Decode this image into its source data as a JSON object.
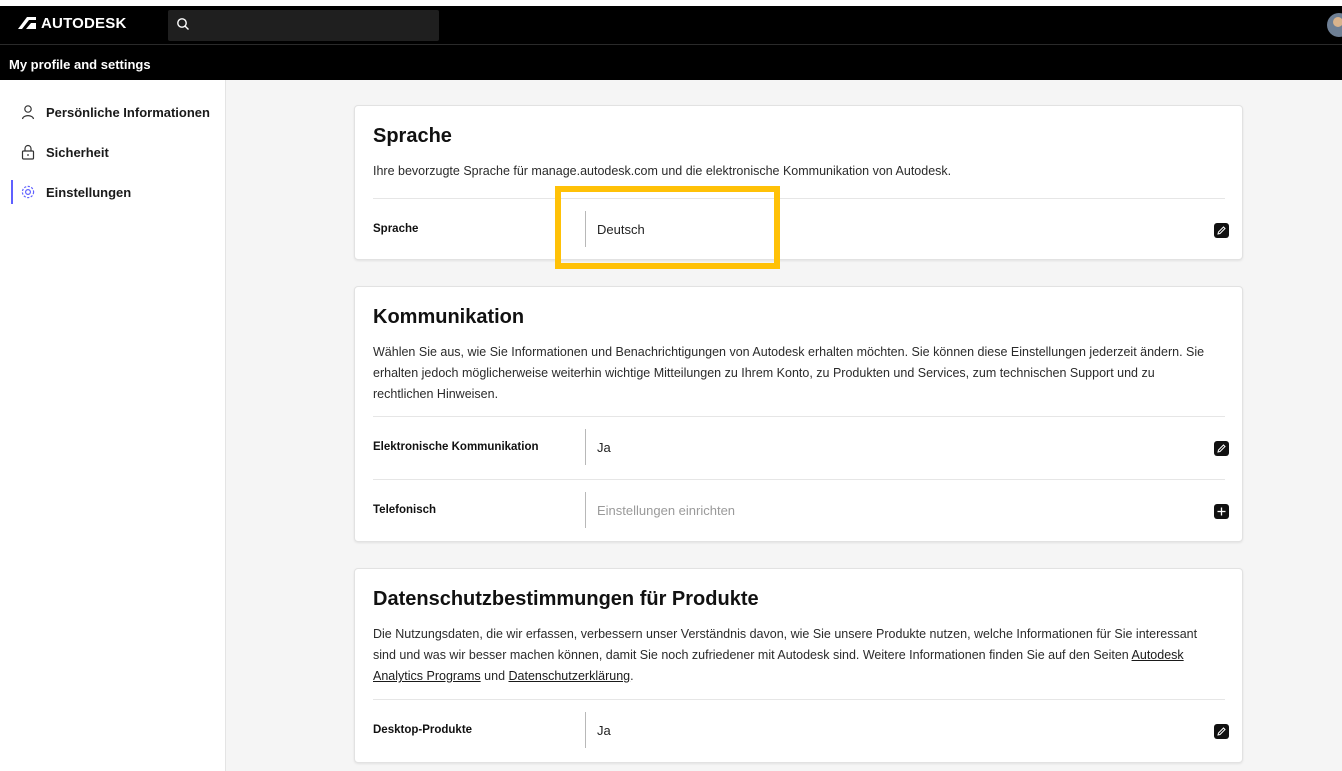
{
  "header": {
    "brand": "AUTODESK",
    "search_placeholder": "",
    "subtitle": "My profile and settings"
  },
  "sidebar": {
    "items": [
      {
        "label": "Persönliche Informationen",
        "icon": "person-icon",
        "active": false
      },
      {
        "label": "Sicherheit",
        "icon": "lock-icon",
        "active": false
      },
      {
        "label": "Einstellungen",
        "icon": "gear-icon",
        "active": true
      }
    ]
  },
  "sections": {
    "language": {
      "title": "Sprache",
      "description": "Ihre bevorzugte Sprache für manage.autodesk.com und die elektronische Kommunikation von Autodesk.",
      "rows": [
        {
          "label": "Sprache",
          "value": "Deutsch",
          "action": "edit-icon"
        }
      ]
    },
    "communication": {
      "title": "Kommunikation",
      "description": "Wählen Sie aus, wie Sie Informationen und Benachrichtigungen von Autodesk erhalten möchten. Sie können diese Einstellungen jederzeit ändern. Sie erhalten jedoch möglicherweise weiterhin wichtige Mitteilungen zu Ihrem Konto, zu Produkten und Services, zum technischen Support und zu rechtlichen Hinweisen.",
      "rows": [
        {
          "label": "Elektronische Kommunikation",
          "value": "Ja",
          "action": "edit-icon"
        },
        {
          "label": "Telefonisch",
          "value": "Einstellungen einrichten",
          "action": "plus-icon"
        }
      ]
    },
    "privacy": {
      "title": "Datenschutzbestimmungen für Produkte",
      "description_before": "Die Nutzungsdaten, die wir erfassen, verbessern unser Verständnis davon, wie Sie unsere Produkte nutzen, welche Informationen für Sie interessant sind und was wir besser machen können, damit Sie noch zufriedener mit Autodesk sind. Weitere Informationen finden Sie auf den Seiten ",
      "link1": "Autodesk Analytics Programs",
      "description_mid": " und ",
      "link2": "Datenschutzerklärung",
      "description_after": ".",
      "rows": [
        {
          "label": "Desktop-Produkte",
          "value": "Ja",
          "action": "edit-icon"
        }
      ]
    }
  },
  "colors": {
    "highlight": "#ffc107",
    "active_indicator": "#5f60ff"
  }
}
